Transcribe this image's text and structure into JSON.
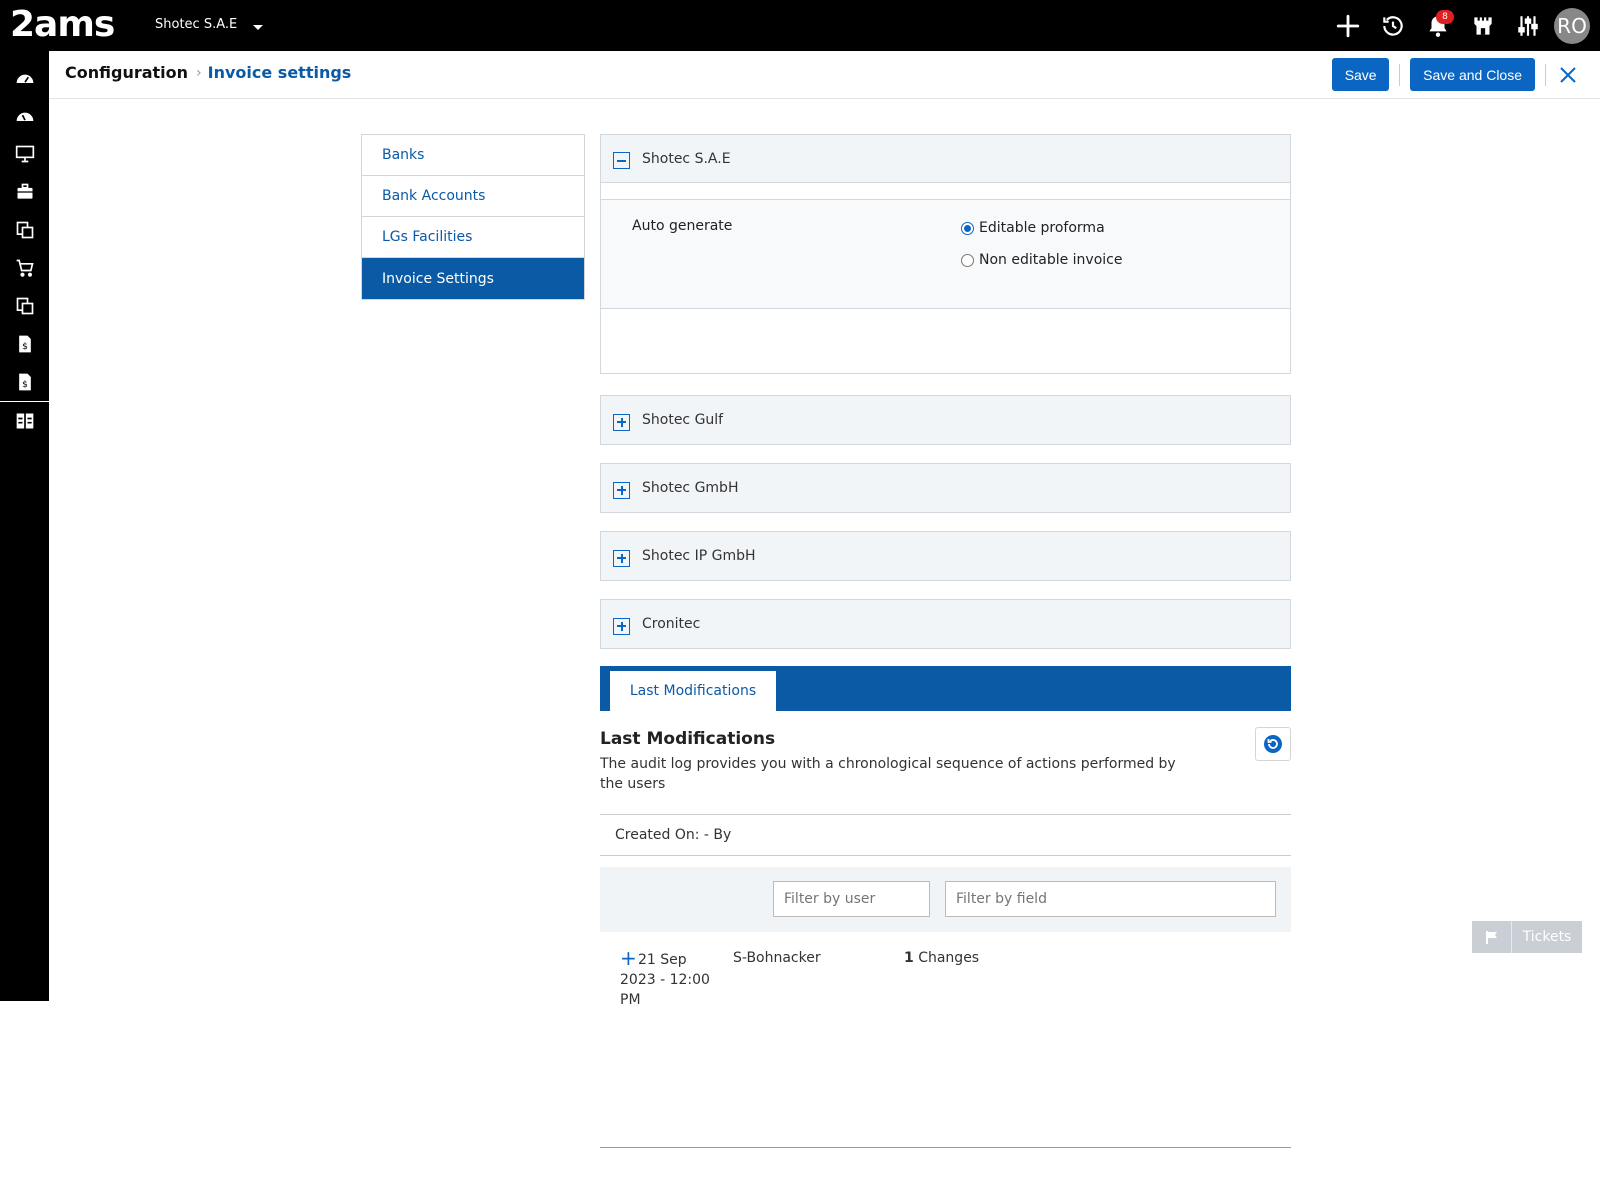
{
  "topbar": {
    "logo_text": "2ams",
    "company": "Shotec S.A.E",
    "notification_count": "8",
    "avatar_initials": "RO",
    "icons": [
      "plus-icon",
      "history-icon",
      "bell-icon",
      "castle-icon",
      "sliders-icon"
    ]
  },
  "sidebar": {
    "icons": [
      "dashboard-icon",
      "dashboard-alt-icon",
      "monitor-icon",
      "briefcase-icon",
      "documents-icon",
      "cart-icon",
      "documents-alt-icon",
      "invoice-icon",
      "invoice-alt-icon",
      "grid-icon"
    ]
  },
  "breadcrumb": {
    "root": "Configuration",
    "current": "Invoice settings"
  },
  "actions": {
    "save": "Save",
    "save_close": "Save and Close"
  },
  "settings_nav": {
    "items": [
      {
        "label": "Banks"
      },
      {
        "label": "Bank Accounts"
      },
      {
        "label": "LGs Facilities"
      },
      {
        "label": "Invoice Settings"
      }
    ],
    "active_index": 3
  },
  "companies": [
    {
      "name": "Shotec S.A.E",
      "expanded": true
    },
    {
      "name": "Shotec Gulf",
      "expanded": false
    },
    {
      "name": "Shotec GmbH",
      "expanded": false
    },
    {
      "name": "Shotec IP GmbH",
      "expanded": false
    },
    {
      "name": "Cronitec",
      "expanded": false
    }
  ],
  "auto_generate": {
    "label": "Auto generate",
    "options": [
      {
        "label": "Editable proforma",
        "selected": true
      },
      {
        "label": "Non editable invoice",
        "selected": false
      }
    ]
  },
  "last_modifications": {
    "tab_label": "Last Modifications",
    "title": "Last Modifications",
    "description": "The audit log provides you with a chronological sequence of actions performed by the users",
    "created_on": "Created On: - By",
    "filter_user_placeholder": "Filter by user",
    "filter_field_placeholder": "Filter by field",
    "rows": [
      {
        "date": "21 Sep 2023 - 12:00 PM",
        "user": "S-Bohnacker",
        "count": "1",
        "count_label": "Changes"
      }
    ]
  },
  "tickets": {
    "label": "Tickets"
  },
  "colors": {
    "primary": "#0b66c3",
    "primary_dark": "#0b5aa6",
    "topbar": "#000000",
    "badge": "#e02020"
  }
}
